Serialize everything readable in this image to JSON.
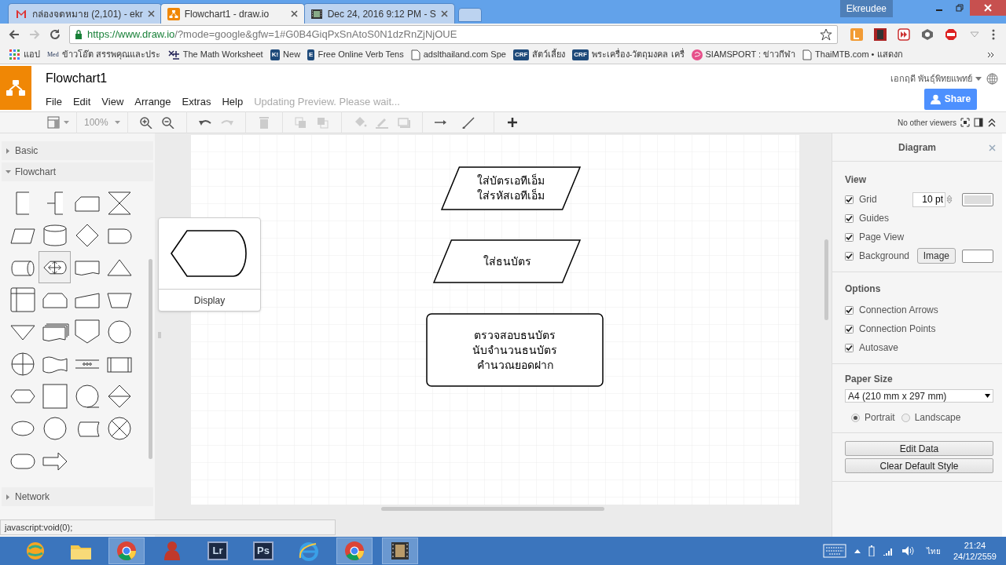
{
  "browser": {
    "tabs": [
      {
        "title": "กล่องจดหมาย (2,101) - ekr",
        "selected": false
      },
      {
        "title": "Flowchart1 - draw.io",
        "selected": true
      },
      {
        "title": "Dec 24, 2016 9:12 PM - S",
        "selected": false
      }
    ],
    "user": "Ekreudee",
    "address": {
      "host": "https://www.draw.io",
      "path": "/?mode=google&gfw=1#G0B4GiqPxSnAtoS0N1dzRnZjNjOUE"
    },
    "bookmarks": [
      {
        "label": "แอป"
      },
      {
        "label": "ข้าวโอ๊ต สรรพคุณและประ",
        "icon_text": "Med"
      },
      {
        "label": "The Math Worksheet"
      },
      {
        "label": "New",
        "icon_text": "K!"
      },
      {
        "label": "Free Online Verb Tens",
        "icon_text": "E"
      },
      {
        "label": "adslthailand.com Spe"
      },
      {
        "label": "สัตว์เลี้ยง",
        "icon_text": "CRF"
      },
      {
        "label": "พระเครื่อง-วัตถุมงคล เครื่",
        "icon_text": "CRF"
      },
      {
        "label": "SIAMSPORT : ข่าวกีฬา"
      },
      {
        "label": "ThaiMTB.com • แสดงก"
      }
    ]
  },
  "app": {
    "title": "Flowchart1",
    "menus": [
      "File",
      "Edit",
      "View",
      "Arrange",
      "Extras",
      "Help"
    ],
    "status": "Updating Preview. Please wait...",
    "user": "เอกฤดี พันธุ์พิทยแพทย์",
    "share": "Share",
    "zoom": "100%",
    "viewers": "No other viewers"
  },
  "sidebar": {
    "sections": [
      {
        "title": "Basic",
        "expanded": false
      },
      {
        "title": "Flowchart",
        "expanded": true,
        "shapes": [
          {
            "kind": "annotation1",
            "selected": false
          },
          {
            "kind": "annotation2",
            "selected": false
          },
          {
            "kind": "card",
            "selected": false
          },
          {
            "kind": "collate",
            "selected": false
          },
          {
            "kind": "data",
            "selected": false
          },
          {
            "kind": "database",
            "selected": false
          },
          {
            "kind": "decision",
            "selected": false
          },
          {
            "kind": "delay",
            "selected": false
          },
          {
            "kind": "direct",
            "selected": false
          },
          {
            "kind": "display",
            "selected": true
          },
          {
            "kind": "document",
            "selected": false
          },
          {
            "kind": "extract",
            "selected": false
          },
          {
            "kind": "internal",
            "selected": false
          },
          {
            "kind": "loop",
            "selected": false
          },
          {
            "kind": "manualinput",
            "selected": false
          },
          {
            "kind": "manualop",
            "selected": false
          },
          {
            "kind": "merge",
            "selected": false
          },
          {
            "kind": "multidoc",
            "selected": false
          },
          {
            "kind": "offpage",
            "selected": false
          },
          {
            "kind": "onpage",
            "selected": false
          },
          {
            "kind": "or",
            "selected": false
          },
          {
            "kind": "tape",
            "selected": false
          },
          {
            "kind": "parallel",
            "selected": false
          },
          {
            "kind": "predefined",
            "selected": false
          },
          {
            "kind": "preparation",
            "selected": false
          },
          {
            "kind": "process",
            "selected": false
          },
          {
            "kind": "sequential",
            "selected": false
          },
          {
            "kind": "sort",
            "selected": false
          },
          {
            "kind": "start1",
            "selected": false
          },
          {
            "kind": "start2",
            "selected": false
          },
          {
            "kind": "stored",
            "selected": false
          },
          {
            "kind": "summing",
            "selected": false
          },
          {
            "kind": "terminator",
            "selected": false
          },
          {
            "kind": "transfer",
            "selected": false
          }
        ]
      },
      {
        "title": "Network",
        "expanded": false
      }
    ]
  },
  "tooltip": {
    "label": "Display"
  },
  "canvas": {
    "shapes": [
      {
        "kind": "data",
        "text": "ใส่บัตรเอทีเอ็ม\nใส่รหัสเอทีเอ็ม"
      },
      {
        "kind": "data",
        "text": "ใส่ธนบัตร"
      },
      {
        "kind": "process",
        "text": "ตรวจสอบธนบัตร\nนับจำนวนธนบัตร\nคำนวณยอดฝาก"
      }
    ]
  },
  "format_panel": {
    "title": "Diagram",
    "view": {
      "title": "View",
      "options": [
        {
          "label": "Grid",
          "checked": true
        },
        {
          "label": "Guides",
          "checked": true
        },
        {
          "label": "Page View",
          "checked": true
        },
        {
          "label": "Background",
          "checked": true
        }
      ],
      "grid_size": "10 pt",
      "image_button": "Image"
    },
    "options": {
      "title": "Options",
      "options": [
        {
          "label": "Connection Arrows",
          "checked": true
        },
        {
          "label": "Connection Points",
          "checked": true
        },
        {
          "label": "Autosave",
          "checked": true
        }
      ]
    },
    "paper": {
      "title": "Paper Size",
      "size": "A4 (210 mm x 297 mm)",
      "orientations": [
        {
          "label": "Portrait",
          "selected": true
        },
        {
          "label": "Landscape",
          "selected": false
        }
      ]
    },
    "buttons": [
      "Edit Data",
      "Clear Default Style"
    ]
  },
  "status_text": "javascript:void(0);",
  "taskbar": {
    "apps": [
      {
        "active": false
      },
      {
        "active": false
      },
      {
        "active": true
      },
      {
        "active": false
      },
      {
        "label": "Lr",
        "active": false
      },
      {
        "label": "Ps",
        "active": false
      },
      {
        "active": false
      },
      {
        "active": true
      },
      {
        "active": true
      }
    ],
    "language": "ไทย",
    "time": "21:24",
    "date": "24/12/2559"
  }
}
